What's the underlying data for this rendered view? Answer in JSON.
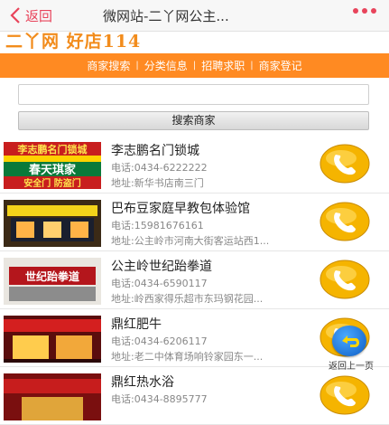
{
  "header": {
    "back_label": "返回",
    "title": "微网站-二丫网公主...",
    "more_icon": "more-dots-icon"
  },
  "logo": {
    "text": "二丫网 好店114"
  },
  "nav": {
    "items": [
      "商家搜索",
      "分类信息",
      "招聘求职",
      "商家登记"
    ],
    "separator": "|"
  },
  "search": {
    "placeholder": "",
    "value": "",
    "button_label": "搜索商家"
  },
  "listings": [
    {
      "name": "李志鹏名门锁城",
      "phone": "电话:0434-6222222",
      "address": "地址:新华书店南三门",
      "thumb_text_top": "李志鹏名门锁城",
      "thumb_text_mid": "春天琪家",
      "thumb_text_bot": "安全门 防盗门"
    },
    {
      "name": "巴布豆家庭早教包体验馆",
      "phone": "电话:15981676161",
      "address": "地址:公主岭市河南大街客运站西1...",
      "thumb_text_top": "",
      "thumb_text_mid": "",
      "thumb_text_bot": ""
    },
    {
      "name": "公主岭世纪跆拳道",
      "phone": "电话:0434-6590117",
      "address": "地址:岭西家得乐超市东玛钢花园...",
      "thumb_text_top": "",
      "thumb_text_mid": "世纪跆拳道",
      "thumb_text_bot": ""
    },
    {
      "name": "鼎红肥牛",
      "phone": "电话:0434-6206117",
      "address": "地址:老二中体育场响铃家园东一...",
      "thumb_text_top": "",
      "thumb_text_mid": "",
      "thumb_text_bot": ""
    },
    {
      "name": "鼎红热水浴",
      "phone": "电话:0434-8895777",
      "address": "",
      "thumb_text_top": "",
      "thumb_text_mid": "",
      "thumb_text_bot": ""
    }
  ],
  "float_button": {
    "label": "返回上一页"
  },
  "colors": {
    "accent": "#e8445b",
    "nav_bg": "#ff8a22",
    "logo": "#f28c1c",
    "call_icon": "#f5b400"
  }
}
